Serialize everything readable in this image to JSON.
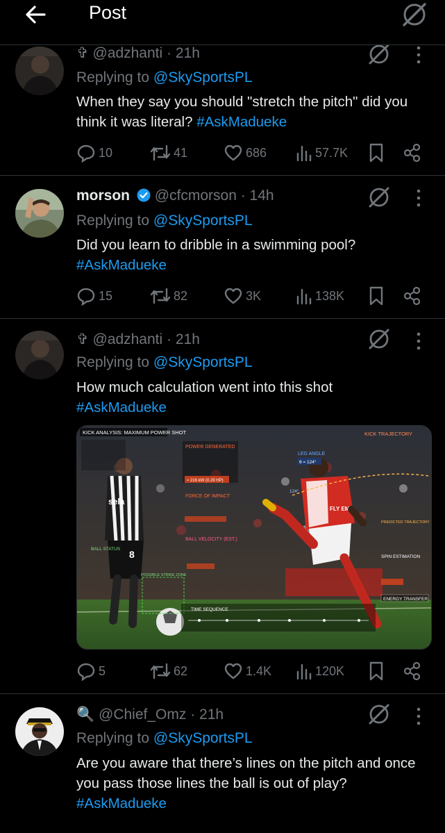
{
  "header": {
    "title": "Post"
  },
  "tweets": [
    {
      "display_name": "",
      "prefix": "✞",
      "handle": "@adzhanti",
      "time": "· 21h",
      "replying_prefix": "Replying to",
      "replying_handle": "@SkySportsPL",
      "text": "When they say you should \"stretch the pitch\" did you think it was literal?",
      "hashtag": "#AskMadueke",
      "replies": "10",
      "reposts": "41",
      "likes": "686",
      "views": "57.7K"
    },
    {
      "display_name": "morson",
      "prefix": "",
      "handle": "@cfcmorson",
      "time": "· 14h",
      "replying_prefix": "Replying to",
      "replying_handle": "@SkySportsPL",
      "text": "Did you learn to dribble in a swimming pool?",
      "hashtag": "#AskMadueke",
      "replies": "15",
      "reposts": "82",
      "likes": "3K",
      "views": "138K"
    },
    {
      "display_name": "",
      "prefix": "✞",
      "handle": "@adzhanti",
      "time": "· 21h",
      "replying_prefix": "Replying to",
      "replying_handle": "@SkySportsPL",
      "text": "How much calculation went into this shot",
      "hashtag": "#AskMadueke",
      "replies": "5",
      "reposts": "62",
      "likes": "1.4K",
      "views": "120K",
      "media": {
        "kick_analysis_title": "KICK ANALYSIS: MAXIMUM POWER SHOT",
        "kick_trajectory": "KICK TRAJECTORY",
        "power_generated": "POWER GENERATED",
        "force_of_impact": "FORCE OF IMPACT",
        "ball_velocity": "BALL VELOCITY (EST.)",
        "leg_angle": "LEG ANGLE",
        "time_sequence": "TIME SEQUENCE",
        "spin_estimation": "SPIN ESTIMATION",
        "energy_transfer": "ENERGY TRANSFER",
        "ball_status": "BALL STATUS",
        "predicted_trajectory": "PREDICTED TRAJECTORY",
        "possible_strike_zone": "POSSIBLE STRIKE ZONE",
        "angle_value": "θ = 124°",
        "angle_label": "124°",
        "power_value": "≈ 216 kW (0.29 HP)",
        "left_shirt_text": "sela",
        "left_shirt_number": "8",
        "right_shirt_text": "FLY EM"
      }
    },
    {
      "display_name": "",
      "prefix": "🔍",
      "handle": "@Chief_Omz",
      "time": "· 21h",
      "replying_prefix": "Replying to",
      "replying_handle": "@SkySportsPL",
      "text": "Are you aware that there’s lines on the pitch and once you pass those lines the ball is out of play?",
      "hashtag": "#AskMadueke"
    }
  ],
  "colors": {
    "accent": "#1d9bf0",
    "muted": "#71767b",
    "bg": "#000000",
    "text": "#e7e9ea"
  }
}
